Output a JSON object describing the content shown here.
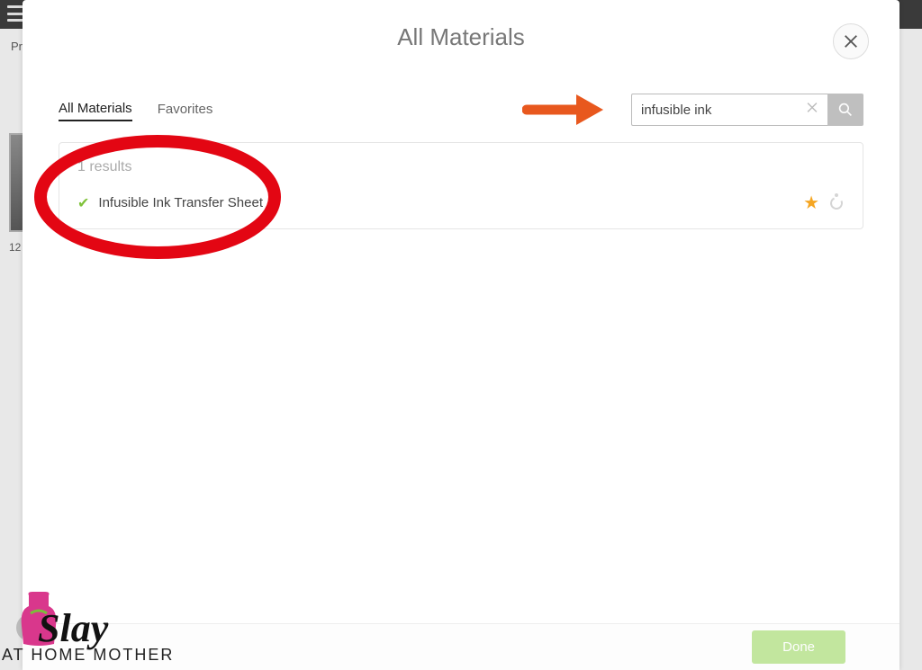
{
  "background": {
    "label_top": "Pr",
    "thumb_label": "12"
  },
  "modal": {
    "title": "All Materials",
    "tabs": {
      "all": "All Materials",
      "favorites": "Favorites"
    },
    "search": {
      "value": "infusible ink"
    },
    "results": {
      "count_text": "1 results",
      "items": [
        {
          "name": "Infusible Ink Transfer Sheet",
          "favorite": true
        }
      ]
    },
    "footer": {
      "done": "Done"
    }
  },
  "watermark": {
    "main": "Slay",
    "sub": "AT HOME MOTHER"
  },
  "annotations": {
    "arrow_color": "#e8581e",
    "oval_color": "#e30613"
  }
}
